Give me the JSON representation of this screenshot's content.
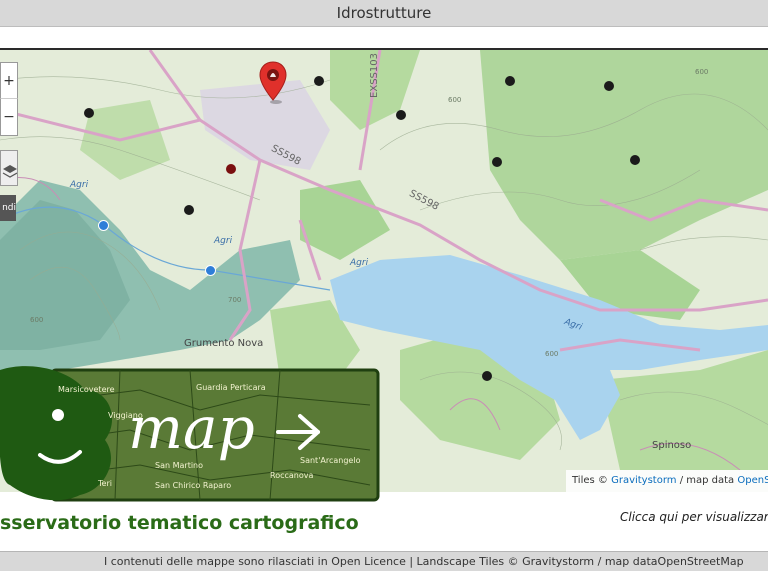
{
  "header": {
    "title": "Idrostrutture"
  },
  "map": {
    "controls": {
      "zoom_in": "+",
      "zoom_out": "−",
      "legend_tab": "ndi"
    },
    "attribution": {
      "prefix": "Tiles © ",
      "tiles_link": "Gravitystorm",
      "sep": " / map data ",
      "data_link": "OpenStreetMap"
    },
    "places": {
      "grumento": "Grumento Nova",
      "spinoso": "Spinoso"
    },
    "roads": {
      "ss598_a": "SS598",
      "ss598_b": "SS598",
      "exss103": "EXSS103"
    },
    "rivers": {
      "agri_1": "Agri",
      "agri_2": "Agri",
      "agri_3": "Agri",
      "agri_4": "Agri"
    },
    "contours": {
      "c600a": "600",
      "c700": "700",
      "c600b": "600",
      "c600c": "600",
      "c600d": "600"
    },
    "icons": {
      "selected_marker": "map-pin-marker",
      "points": "structure-point"
    }
  },
  "logo": {
    "word": "map",
    "subtitle": "sservatorio tematico cartografico",
    "towns": [
      "Marsicovetere",
      "Guardia Perticara",
      "Viggiano",
      "Sant'Arcangelo",
      "San Martino",
      "Roccanova",
      "San Chirico Raparo",
      "Teri"
    ]
  },
  "hint": "Clicca qui per visualizzare",
  "footer": {
    "text": "I contenuti delle mappe sono rilasciati in Open Licence | Landscape Tiles © Gravitystorm / map dataOpenStreetMap"
  },
  "colors": {
    "lake": "#a9d3ee",
    "forest": "#9dcf8a",
    "road": "#d9a3c7",
    "marker": "#e0302b",
    "logo_green": "#2a6b17"
  }
}
